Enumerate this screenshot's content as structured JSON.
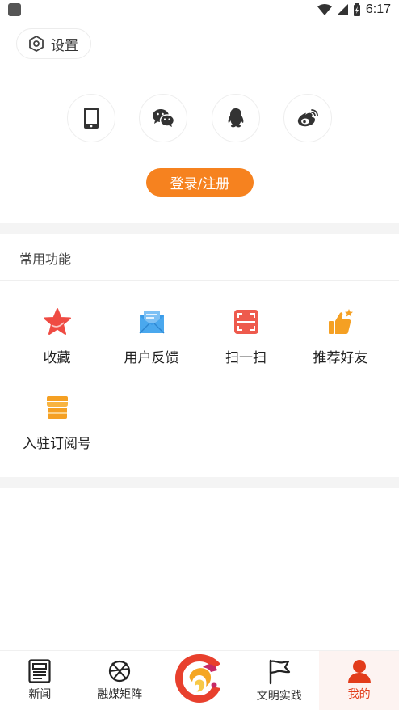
{
  "status_bar": {
    "time": "6:17"
  },
  "settings": {
    "label": "设置",
    "icon": "hexagon-gear-icon"
  },
  "login_methods": [
    {
      "name": "phone",
      "icon": "phone-icon"
    },
    {
      "name": "wechat",
      "icon": "wechat-icon"
    },
    {
      "name": "qq",
      "icon": "qq-icon"
    },
    {
      "name": "weibo",
      "icon": "weibo-icon"
    }
  ],
  "login_button": {
    "label": "登录/注册",
    "color": "#f6821f"
  },
  "common_functions": {
    "title": "常用功能",
    "items": [
      {
        "label": "收藏",
        "icon": "star-icon",
        "color": "#ef4b43"
      },
      {
        "label": "用户反馈",
        "icon": "envelope-icon",
        "color": "#3a9be8"
      },
      {
        "label": "扫一扫",
        "icon": "scan-icon",
        "color": "#ee5a4d"
      },
      {
        "label": "推荐好友",
        "icon": "thumbs-up-icon",
        "color": "#f5a023"
      },
      {
        "label": "入驻订阅号",
        "icon": "store-icon",
        "color": "#f5a023"
      }
    ]
  },
  "tabbar": {
    "tabs": [
      {
        "label": "新闻",
        "icon": "newspaper-icon"
      },
      {
        "label": "融媒矩阵",
        "icon": "matrix-icon"
      },
      {
        "label": "",
        "icon": "app-logo-icon"
      },
      {
        "label": "文明实践",
        "icon": "flag-icon"
      },
      {
        "label": "我的",
        "icon": "person-icon",
        "active": true
      }
    ],
    "active_color": "#e23c1b"
  }
}
